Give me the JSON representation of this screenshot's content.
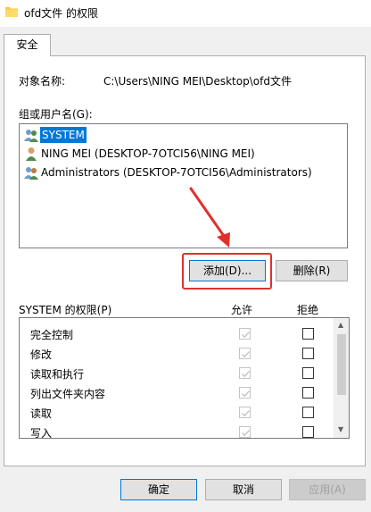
{
  "window": {
    "title": "ofd文件 的权限"
  },
  "tabs": [
    {
      "label": "安全"
    }
  ],
  "object": {
    "label": "对象名称:",
    "path": "C:\\Users\\NING MEI\\Desktop\\ofd文件"
  },
  "users": {
    "label": "组或用户名(G):",
    "items": [
      {
        "name": "SYSTEM",
        "icon": "group-icon",
        "selected": true
      },
      {
        "name": "NING MEI (DESKTOP-7OTCI56\\NING MEI)",
        "icon": "user-icon",
        "selected": false
      },
      {
        "name": "Administrators (DESKTOP-7OTCI56\\Administrators)",
        "icon": "group-icon",
        "selected": false
      }
    ]
  },
  "buttons": {
    "add": "添加(D)...",
    "remove": "删除(R)",
    "ok": "确定",
    "cancel": "取消",
    "apply": "应用(A)"
  },
  "permissions": {
    "label": "SYSTEM 的权限(P)",
    "allow_header": "允许",
    "deny_header": "拒绝",
    "rows": [
      {
        "name": "完全控制",
        "allow": true,
        "deny": false
      },
      {
        "name": "修改",
        "allow": true,
        "deny": false
      },
      {
        "name": "读取和执行",
        "allow": true,
        "deny": false
      },
      {
        "name": "列出文件夹内容",
        "allow": true,
        "deny": false
      },
      {
        "name": "读取",
        "allow": true,
        "deny": false
      },
      {
        "name": "写入",
        "allow": true,
        "deny": false
      }
    ]
  },
  "colors": {
    "selection": "#0078d7",
    "highlight_box": "#e0302c",
    "folder": "#ffc83d"
  }
}
